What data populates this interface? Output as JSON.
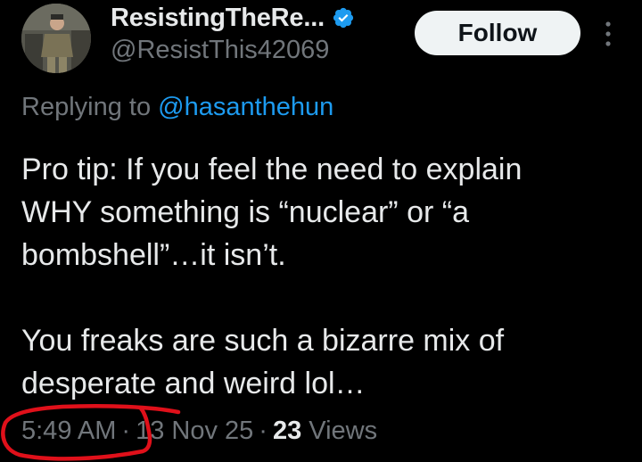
{
  "author": {
    "display_name": "ResistingTheRe...",
    "handle": "@ResistThis42069",
    "verified": true,
    "avatar_icon": "profile-photo"
  },
  "follow_label": "Follow",
  "replying": {
    "prefix": "Replying to",
    "mention": "@hasanthehun"
  },
  "tweet": {
    "lines": [
      "Pro tip: If you feel the need to explain",
      "WHY something is “nuclear” or “a",
      "bombshell”…it isn’t.",
      "",
      "You freaks are such a bizarre mix of",
      "desperate and weird lol…"
    ]
  },
  "meta": {
    "time": "5:49 AM",
    "date": "13 Nov 25",
    "views_count": "23",
    "views_label": "Views",
    "separator": "·"
  },
  "colors": {
    "background": "#000000",
    "text": "#e7e9ea",
    "muted": "#71767b",
    "accent": "#1d9bf0",
    "annotation": "#e0101a"
  }
}
